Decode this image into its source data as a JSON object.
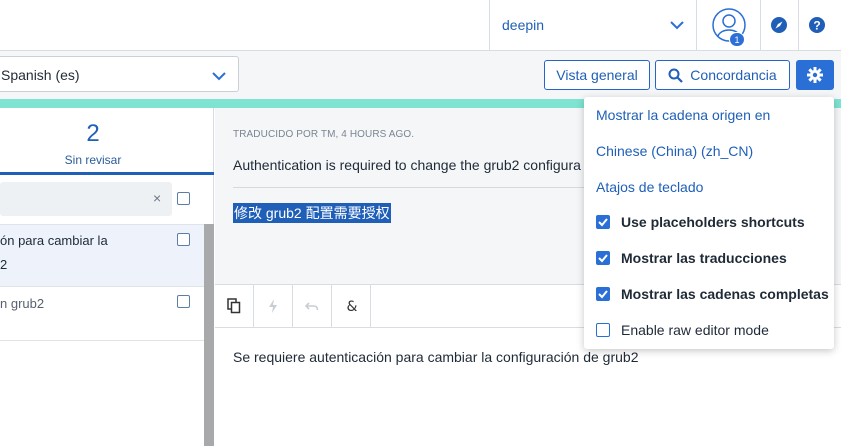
{
  "header": {
    "project": "deepin",
    "notification_count": "1"
  },
  "toolbar": {
    "language_value": "Spanish (es)",
    "overview_label": "Vista general",
    "concordance_label": "Concordancia"
  },
  "sidebar": {
    "stat_value": "2",
    "stat_label": "Sin revisar",
    "search_clear": "×",
    "rows": [
      {
        "line1": "ón para cambiar la",
        "line2": "2"
      },
      {
        "line1": "n grub2"
      }
    ]
  },
  "editor": {
    "meta": "TRADUCIDO POR TM, 4 HOURS AGO.",
    "source_text": "Authentication is required to change the grub2 configura",
    "chinese_text": "修改 grub2 配置需要授权",
    "translation_text": "Se requiere autenticación para cambiar la configuración de grub2"
  },
  "settings_menu": {
    "link1": "Mostrar la cadena origen en",
    "link2": "Chinese (China) (zh_CN)",
    "link3": "Atajos de teclado",
    "options": [
      {
        "label": "Use placeholders shortcuts",
        "checked": true
      },
      {
        "label": "Mostrar las traducciones",
        "checked": true
      },
      {
        "label": "Mostrar las cadenas completas",
        "checked": true
      },
      {
        "label": "Enable raw editor mode",
        "checked": false
      }
    ]
  },
  "colors": {
    "accent": "#2a6fd5",
    "progress": "#7ee3d1",
    "link": "#1f5fb8"
  }
}
